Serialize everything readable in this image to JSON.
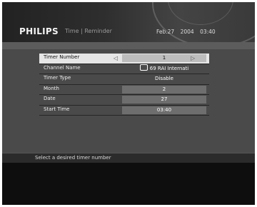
{
  "header": {
    "brand": "PHILIPS",
    "breadcrumb": "Time | Reminder",
    "date": "Feb.27 2004",
    "time": "03:40"
  },
  "menu": {
    "rows": [
      {
        "label": "Timer Number",
        "value": "1"
      },
      {
        "label": "Channel Name",
        "value": "69 RAI Internati"
      },
      {
        "label": "Timer Type",
        "value": "Disable"
      },
      {
        "label": "Month",
        "value": "2"
      },
      {
        "label": "Date",
        "value": "27"
      },
      {
        "label": "Start Time",
        "value": "03:40"
      }
    ],
    "left_arrow": "◁",
    "right_arrow": "▷",
    "channel_icon": "tv-icon"
  },
  "status": {
    "hint": "Select a desired timer number"
  }
}
